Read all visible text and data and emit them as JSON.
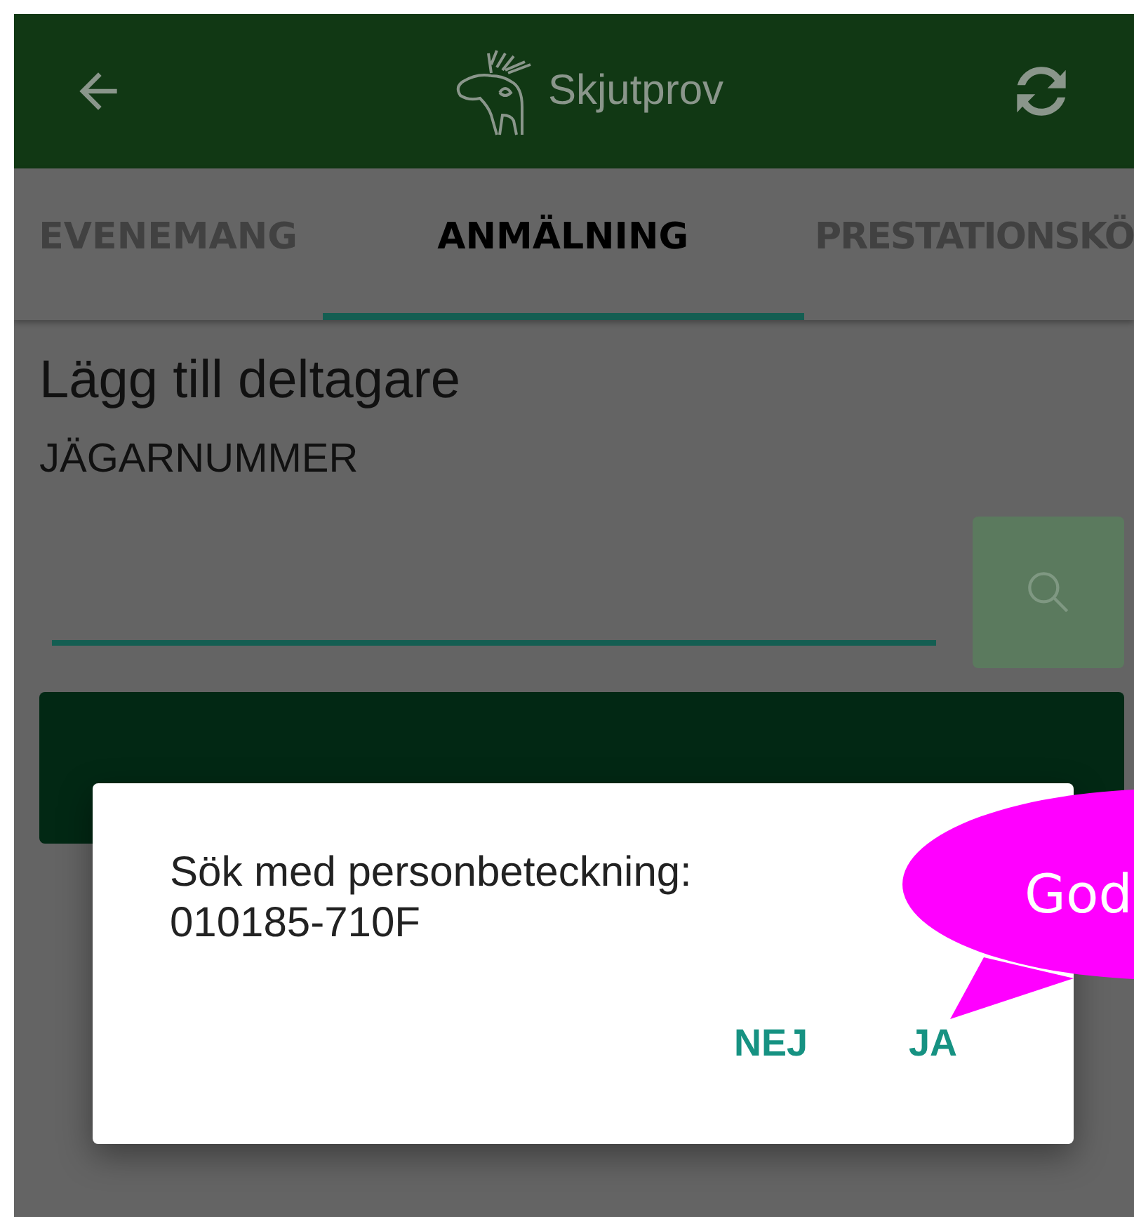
{
  "app_bar": {
    "title": "Skjutprov"
  },
  "tabs": [
    {
      "label": "EVENEMANG",
      "selected": false
    },
    {
      "label": "ANMÄLNING",
      "selected": true
    },
    {
      "label": "PRESTATIONSKÖ",
      "selected": false
    }
  ],
  "form": {
    "title": "Lägg till deltagare",
    "field_label": "JÄGARNUMMER"
  },
  "dialog": {
    "message": "Sök med personbeteckning:",
    "value": "010185-710F",
    "buttons": [
      "NEJ",
      "JA"
    ]
  },
  "callout": {
    "text": "God"
  }
}
